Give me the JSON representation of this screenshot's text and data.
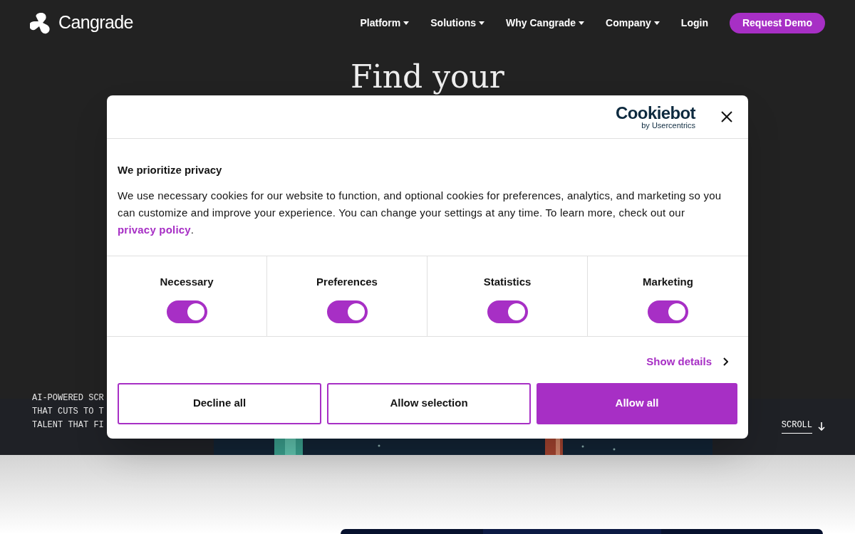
{
  "header": {
    "logo": "Cangrade",
    "nav": [
      {
        "label": "Platform",
        "dropdown": true
      },
      {
        "label": "Solutions",
        "dropdown": true
      },
      {
        "label": "Why Cangrade",
        "dropdown": true
      },
      {
        "label": "Company",
        "dropdown": true
      },
      {
        "label": "Login",
        "dropdown": false
      }
    ],
    "cta": "Request Demo"
  },
  "hero": {
    "heading": "Find your",
    "tagline": [
      "AI-POWERED SCR",
      "THAT CUTS TO T",
      "TALENT THAT FI"
    ],
    "scroll": "SCROLL"
  },
  "cookie_dialog": {
    "brand": "Cookiebot",
    "brand_sub": "by Usercentrics",
    "title": "We prioritize privacy",
    "text": "We use necessary cookies for our website to function, and optional cookies for preferences, analytics, and marketing so you can customize and improve your experience. You can change your settings at any time. To learn more, check out our",
    "link": "privacy policy",
    "text_end": ".",
    "toggles": [
      {
        "label": "Necessary",
        "checked": true
      },
      {
        "label": "Preferences",
        "checked": true
      },
      {
        "label": "Statistics",
        "checked": true
      },
      {
        "label": "Marketing",
        "checked": true
      }
    ],
    "show_details": "Show details",
    "buttons": [
      {
        "label": "Decline all",
        "kind": "outline"
      },
      {
        "label": "Allow selection",
        "kind": "outline"
      },
      {
        "label": "Allow all",
        "kind": "filled"
      }
    ]
  }
}
